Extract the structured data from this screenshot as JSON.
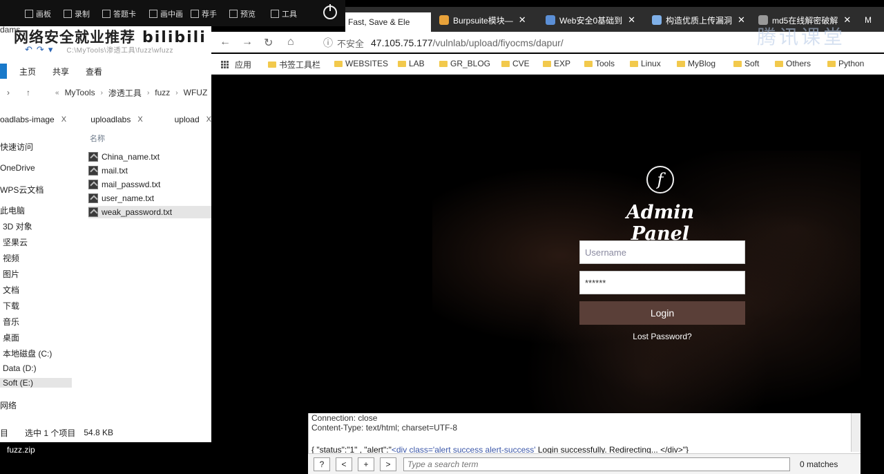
{
  "recorder": {
    "tools": [
      "画板",
      "录制",
      "答题卡",
      "画中画",
      "荐手",
      "预览",
      "工具"
    ],
    "overlay_text": "dams"
  },
  "bilibili": {
    "text": "网络安全就业推荐",
    "logo": "bilibili"
  },
  "browser": {
    "tabs": [
      {
        "label": "Fast, Save & Ele",
        "active": true
      },
      {
        "label": "Burpsuite模块—",
        "active": false
      },
      {
        "label": "Web安全0基础到",
        "active": false
      },
      {
        "label": "构造优质上传漏洞",
        "active": false
      },
      {
        "label": "md5在线解密破解",
        "active": false
      },
      {
        "label": "M",
        "active": false
      }
    ],
    "address": {
      "insecure_label": "不安全",
      "host": "47.105.75.177",
      "path": "/vulnlab/upload/fiyocms/dapur/"
    },
    "bookmarks": [
      "应用",
      "书签工具栏",
      "WEBSITES",
      "LAB",
      "GR_BLOG",
      "CVE",
      "EXP",
      "Tools",
      "Linux",
      "MyBlog",
      "Soft",
      "Others",
      "Python"
    ],
    "watermark": "腾讯课堂"
  },
  "explorer": {
    "quick_access_path": "C:\\MyTools\\渗透工具\\fuzz\\wfuzz",
    "ribbon": [
      "主页",
      "共享",
      "查看"
    ],
    "breadcrumb": [
      "MyTools",
      "渗透工具",
      "fuzz",
      "WFUZ"
    ],
    "folder_tabs": [
      "oadlabs-image",
      "uploadlabs",
      "upload"
    ],
    "column_header": "名称",
    "sidebar": [
      "快速访问",
      "OneDrive",
      "WPS云文档",
      "此电脑",
      "3D 对象",
      "坚果云",
      "视频",
      "图片",
      "文档",
      "下载",
      "音乐",
      "桌面",
      "本地磁盘 (C:)",
      "Data (D:)",
      "Soft (E:)",
      "网络"
    ],
    "files": [
      "China_name.txt",
      "mail.txt",
      "mail_passwd.txt",
      "user_name.txt",
      "weak_password.txt"
    ],
    "status": {
      "items": "目",
      "selected": "选中 1 个项目",
      "size": "54.8 KB"
    }
  },
  "admin_panel": {
    "logo_letter": "f",
    "title": "Admin Panel",
    "username_placeholder": "Username",
    "password_value": "******",
    "login_label": "Login",
    "lost_password": "Lost Password?"
  },
  "burp": {
    "lines": [
      "Connection: close",
      "Content-Type: text/html; charset=UTF-8"
    ],
    "json_prefix": "{ \"status\":\"1\" , \"alert\":\"",
    "json_mid": "<div class='alert success alert-success'",
    "json_suffix": " Login successfully. Redirecting... </div>\"}",
    "buttons": [
      "?",
      "<",
      "+",
      ">"
    ],
    "search_placeholder": "Type a search term",
    "matches": "0 matches"
  },
  "downloads": {
    "file": "fuzz.zip"
  }
}
